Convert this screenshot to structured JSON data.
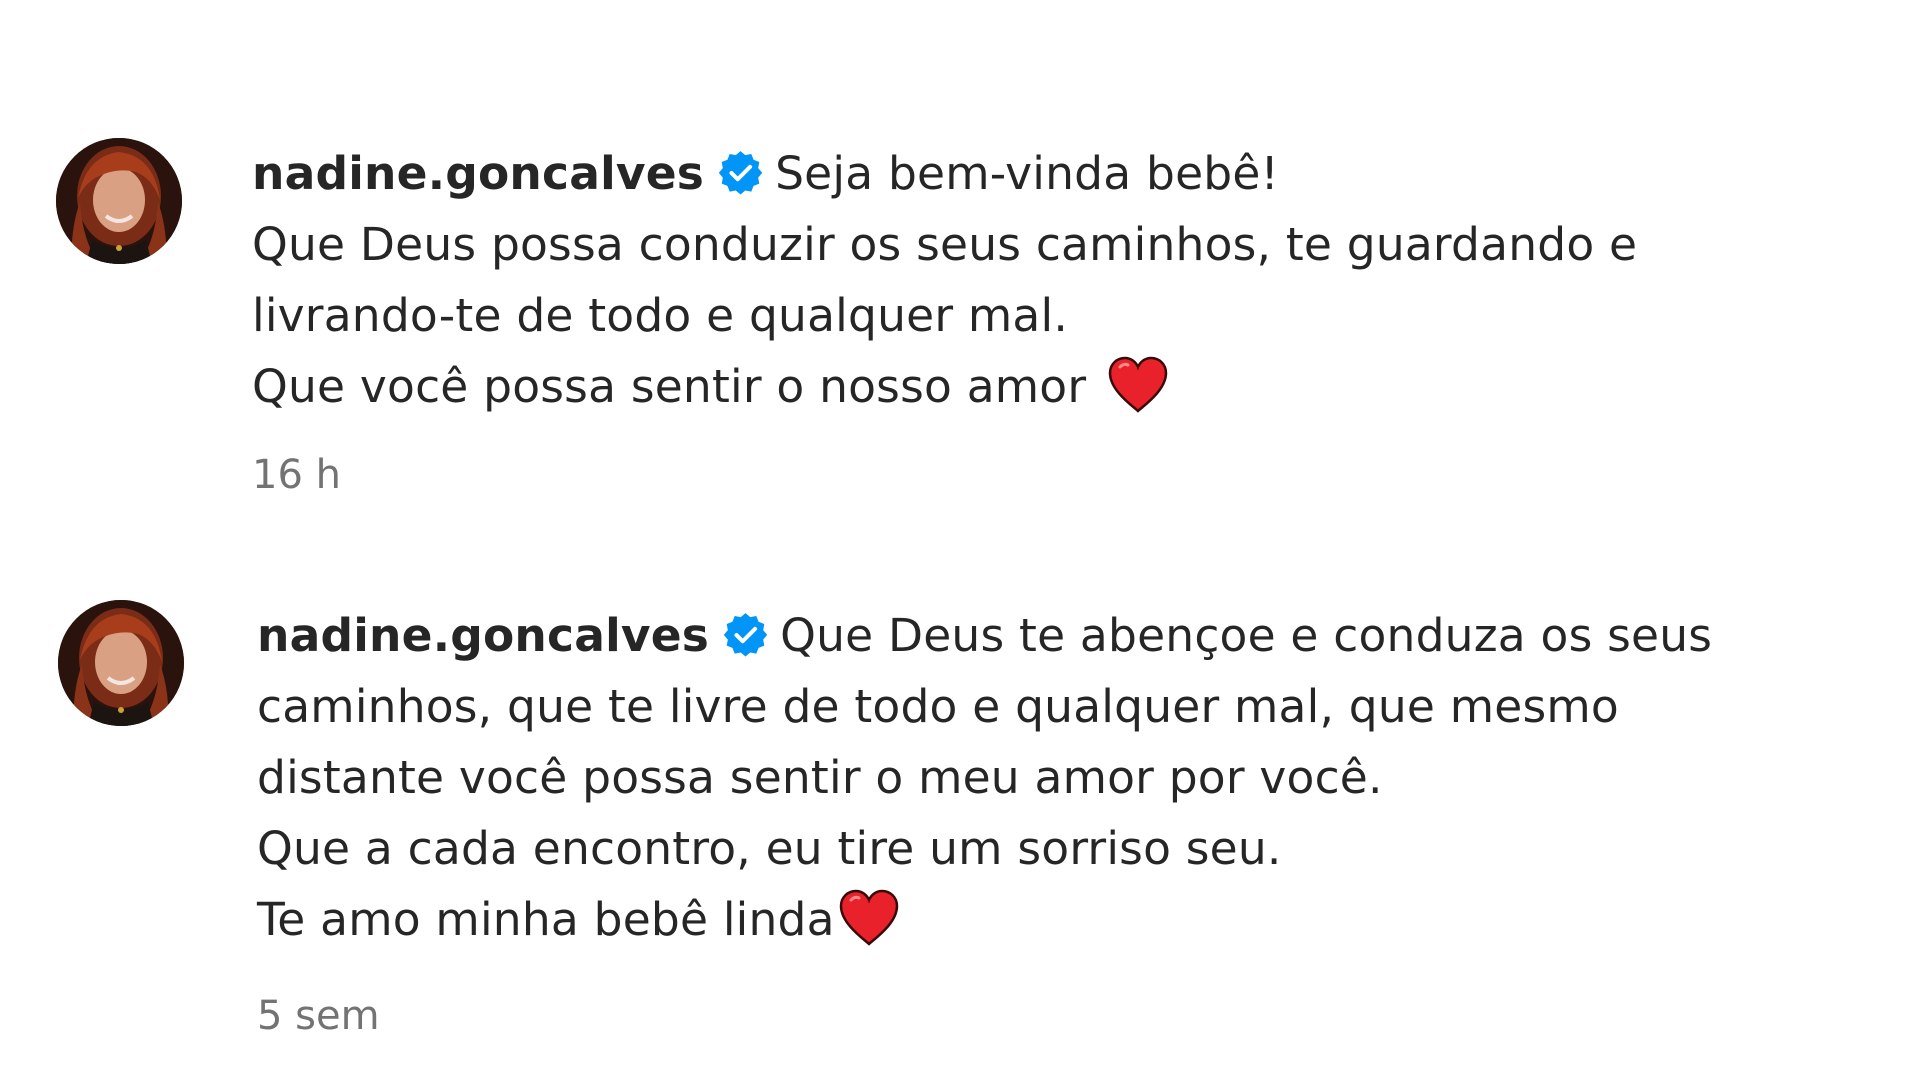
{
  "comments": [
    {
      "username": "nadine.goncalves",
      "avatar_icon": "profile-photo",
      "verified_icon": "verified-badge-icon",
      "lines": [
        "Seja bem-vinda bebê!",
        "Que Deus possa conduzir os seus caminhos, te guardando e",
        "livrando-te de todo e qualquer mal.",
        "Que você possa sentir o nosso amor"
      ],
      "heart_icon": "red-heart-icon",
      "timestamp": "16 h"
    },
    {
      "username": "nadine.goncalves",
      "avatar_icon": "profile-photo",
      "verified_icon": "verified-badge-icon",
      "lines": [
        "Que Deus te abençoe e conduza os seus",
        "caminhos, que te livre de todo e qualquer mal, que mesmo",
        "distante você possa sentir o meu amor por você.",
        "Que a cada encontro, eu tire um sorriso seu.",
        "Te amo minha bebê linda"
      ],
      "heart_icon": "red-heart-icon",
      "timestamp": "5 sem"
    }
  ],
  "colors": {
    "text": "#262626",
    "secondary_text": "#737373",
    "verified_blue": "#0095f6",
    "heart_red": "#e8212b",
    "background": "#ffffff"
  }
}
